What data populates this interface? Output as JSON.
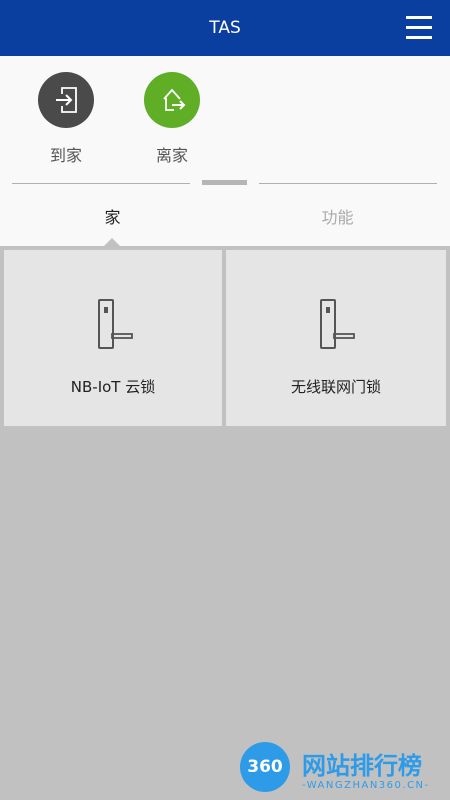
{
  "header": {
    "title": "TAS",
    "menu_icon": "hamburger-menu-icon"
  },
  "scenes": [
    {
      "label": "到家",
      "icon": "arrive-home-icon",
      "color": "#4a4a4a"
    },
    {
      "label": "离家",
      "icon": "leave-home-icon",
      "color": "#5fae25"
    }
  ],
  "tabs": [
    {
      "label": "家",
      "active": true
    },
    {
      "label": "功能",
      "active": false
    }
  ],
  "devices": [
    {
      "name": "NB-IoT 云锁",
      "icon": "door-lock-icon"
    },
    {
      "name": "无线联网门锁",
      "icon": "door-lock-icon"
    }
  ],
  "watermark": {
    "badge": "360",
    "name": "网站排行榜",
    "url": "-WANGZHAN360.CN-"
  },
  "colors": {
    "header": "#0a3fa0",
    "accent_green": "#5fae25",
    "panel": "#f9f9f9",
    "content_bg": "#c1c1c1"
  }
}
